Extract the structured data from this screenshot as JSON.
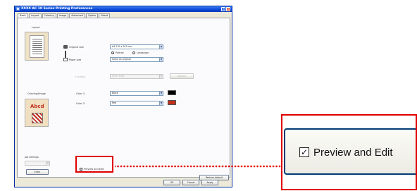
{
  "window": {
    "title": "XXXX AC 10 Series Printing Preferences",
    "help_btn": "?",
    "close_btn": "×"
  },
  "tabs": [
    "Basic",
    "Layout",
    "Coloring",
    "Image",
    "Advanced",
    "Option",
    "About"
  ],
  "layout_section": {
    "label": "Layout"
  },
  "original_size": {
    "label": "Original size",
    "value": "A4 210 x 297 mm"
  },
  "orientation": {
    "portrait": "Portrait",
    "landscape": "Landscape",
    "selected": "portrait"
  },
  "paper_size": {
    "label": "Paper size",
    "value": "Same as original"
  },
  "disabled_row": {
    "label": "Location",
    "value": "Short Edge",
    "button": "Options"
  },
  "coloring": {
    "label": "Coloring/Image",
    "preview_text": "Abcd"
  },
  "color1": {
    "label": "Color 1:",
    "value": "Black",
    "swatch": "#000000"
  },
  "color2": {
    "label": "Color 2:",
    "value": "Red",
    "swatch": "#c0301c"
  },
  "job_settings": {
    "label": "Job settings",
    "entry_button": "Entry"
  },
  "preview_edit": {
    "label": "Preview and Edit",
    "checked": true,
    "check_mark": "✓"
  },
  "restore_button": "Restore default",
  "dialog_buttons": {
    "ok": "OK",
    "cancel": "Cancel",
    "apply": "Apply"
  },
  "colors": {
    "highlight": "#e00000",
    "titlebar": "#0a48d8"
  }
}
